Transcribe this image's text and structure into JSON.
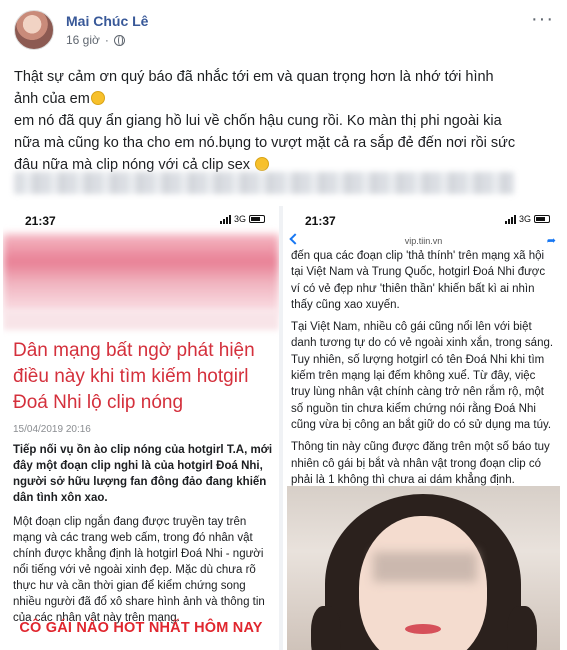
{
  "post": {
    "author": "Mai Chúc Lê",
    "time": "16 giờ",
    "text_lines": [
      "Thật sự cảm ơn quý báo đã nhắc tới em và quan trọng hơn là nhớ tới hình",
      "ảnh của em",
      "em nó đã quy ẩn giang hồ lui về chốn hậu cung rồi. Ko màn thị phi ngoài kia",
      "nữa mà cũng ko tha cho em nó.bụng to vượt mặt cả ra sắp đẻ đến nơi rồi sức",
      "đâu nữa mà clip nóng với cả clip sex"
    ]
  },
  "left_phone": {
    "status_time": "21:37",
    "network": "3G",
    "title": "Dân mạng bất ngờ phát hiện điều này khi tìm kiếm hotgirl Đoá Nhi lộ clip nóng",
    "date": "15/04/2019 20:16",
    "lead": "Tiếp nối vụ ồn ào clip nóng của hotgirl T.A, mới đây một đoạn clip nghi là của hotgirl Đoá Nhi, người sở hữu lượng fan đông đảo đang khiến dân tình xôn xao.",
    "body": "Một đoạn clip ngắn đang được truyền tay trên mạng và các trang web cấm, trong đó nhân vật chính được khẳng định là hotgirl Đoá Nhi - người nổi tiếng với vẻ ngoài xinh đẹp. Mặc dù chưa rõ thực hư và cần thời gian để kiểm chứng song nhiều người đã đổ xô share hình ảnh và thông tin của các nhân vật này trên mạng.",
    "promo": "CÔ GÁI NÀO HOT NHẤT HÔM NAY"
  },
  "right_phone": {
    "status_time": "21:37",
    "network": "3G",
    "url": "vip.tiin.vn",
    "para1": "đến qua các đoạn clip 'thả thính' trên mạng xã hội tại Việt Nam và Trung Quốc, hotgirl Đoá Nhi được ví có vẻ đẹp như 'thiên thần' khiến bất kì ai nhìn thấy cũng xao xuyến.",
    "para2": "Tại Việt Nam, nhiều cô gái cũng nổi lên với biệt danh tương tự do có vẻ ngoài xinh xắn, trong sáng. Tuy nhiên, số lượng hotgirl có tên Đoá Nhi khi tìm kiếm trên mạng lại đếm không xuể. Từ đây, việc truy lùng nhân vật chính càng trở nên rắm rộ, một số nguồn tin chưa kiểm chứng nói rằng Đoá Nhi cũng vừa bị công an bắt giữ do có sử dụng ma túy.",
    "para3": "Thông tin này cũng được đăng trên một số báo tuy nhiên cô gái bị bắt và nhân vật trong đoạn clip có phải là 1 không thì chưa ai dám khẳng định."
  },
  "icons": {
    "more": "more-options-icon",
    "privacy": "globe-icon",
    "emoji": "laughing-emoji-icon"
  }
}
